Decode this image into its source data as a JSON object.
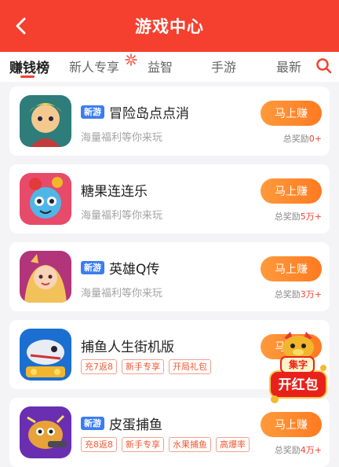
{
  "header": {
    "title": "游戏中心"
  },
  "tabs": [
    {
      "label": "赚钱榜",
      "active": true
    },
    {
      "label": "新人专享"
    },
    {
      "label": "益智"
    },
    {
      "label": "手游"
    },
    {
      "label": "最新"
    }
  ],
  "games": [
    {
      "name": "冒险岛点点消",
      "new": true,
      "badge": "新游",
      "subtitle": "海量福利等你来玩",
      "button": "马上赚",
      "reward_prefix": "总奖励",
      "reward_value": "0+"
    },
    {
      "name": "糖果连连乐",
      "new": false,
      "subtitle": "海量福利等你来玩",
      "button": "马上赚",
      "reward_prefix": "总奖励",
      "reward_value": "5万+"
    },
    {
      "name": "英雄Q传",
      "new": true,
      "badge": "新游",
      "subtitle": "海量福利等你来玩",
      "button": "马上赚",
      "reward_prefix": "总奖励",
      "reward_value": "3万+"
    },
    {
      "name": "捕鱼人生街机版",
      "new": false,
      "tags": [
        "充7返8",
        "新手专享",
        "开局礼包"
      ],
      "button": "马上赚"
    },
    {
      "name": "皮蛋捕鱼",
      "new": true,
      "badge": "新游",
      "tags": [
        "充8返8",
        "新手专享",
        "水果捕鱼",
        "高爆率"
      ],
      "button": "马上赚",
      "reward_prefix": "总奖励",
      "reward_value": "4万+"
    }
  ],
  "floating": {
    "top_label": "集字",
    "main_label": "开红包"
  },
  "colors": {
    "primary": "#f5402f",
    "button": "#ff8a2a",
    "badge": "#3b7cf1"
  }
}
